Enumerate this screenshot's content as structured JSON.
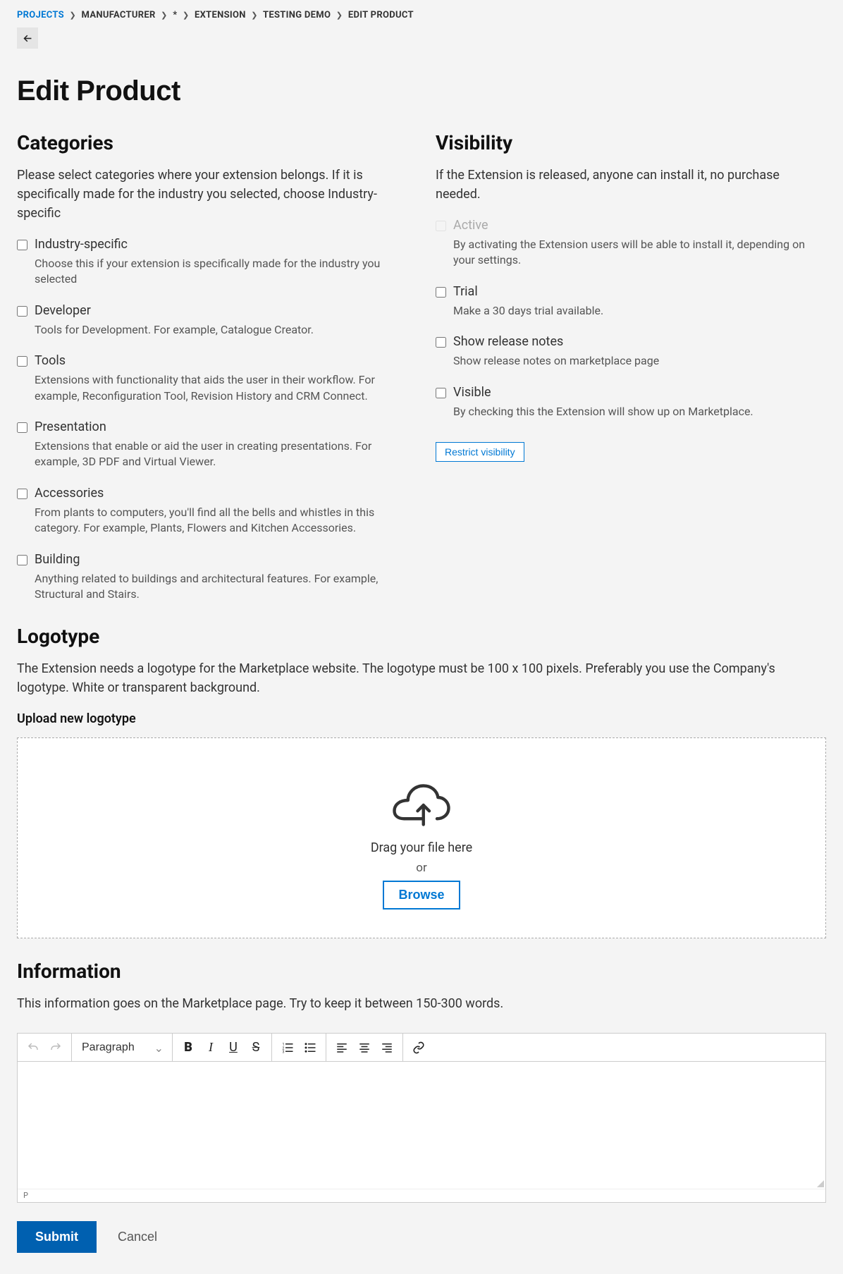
{
  "breadcrumb": {
    "items": [
      "PROJECTS",
      "MANUFACTURER",
      "*",
      "EXTENSION",
      "TESTING DEMO",
      "EDIT PRODUCT"
    ]
  },
  "page_title": "Edit Product",
  "categories": {
    "title": "Categories",
    "desc": "Please select categories where your extension belongs. If it is specifically made for the industry you selected, choose Industry-specific",
    "items": [
      {
        "label": "Industry-specific",
        "sub": "Choose this if your extension is specifically made for the industry you selected"
      },
      {
        "label": "Developer",
        "sub": "Tools for Development. For example, Catalogue Creator."
      },
      {
        "label": "Tools",
        "sub": "Extensions with functionality that aids the user in their workflow. For example, Reconfiguration Tool, Revision History and CRM Connect."
      },
      {
        "label": "Presentation",
        "sub": "Extensions that enable or aid the user in creating presentations. For example, 3D PDF and Virtual Viewer."
      },
      {
        "label": "Accessories",
        "sub": "From plants to computers, you'll find all the bells and whistles in this category. For example, Plants, Flowers and Kitchen Accessories."
      },
      {
        "label": "Building",
        "sub": "Anything related to buildings and architectural features. For example, Structural and Stairs."
      }
    ]
  },
  "visibility": {
    "title": "Visibility",
    "desc": "If the Extension is released, anyone can install it, no purchase needed.",
    "items": [
      {
        "label": "Active",
        "sub": "By activating the Extension users will be able to install it, depending on your settings.",
        "disabled": true
      },
      {
        "label": "Trial",
        "sub": "Make a 30 days trial available."
      },
      {
        "label": "Show release notes",
        "sub": "Show release notes on marketplace page"
      },
      {
        "label": "Visible",
        "sub": "By checking this the Extension will show up on Marketplace."
      }
    ],
    "restrict_btn": "Restrict visibility"
  },
  "logotype": {
    "title": "Logotype",
    "desc": "The Extension needs a logotype for the Marketplace website. The logotype must be 100 x 100 pixels. Preferably you use the Company's logotype. White or transparent background.",
    "upload_title": "Upload new logotype",
    "dz_text": "Drag your file here",
    "dz_or": "or",
    "dz_browse": "Browse"
  },
  "information": {
    "title": "Information",
    "desc": "This information goes on the Marketplace page. Try to keep it between 150-300 words.",
    "format_select": "Paragraph",
    "status": "P"
  },
  "actions": {
    "submit": "Submit",
    "cancel": "Cancel"
  }
}
